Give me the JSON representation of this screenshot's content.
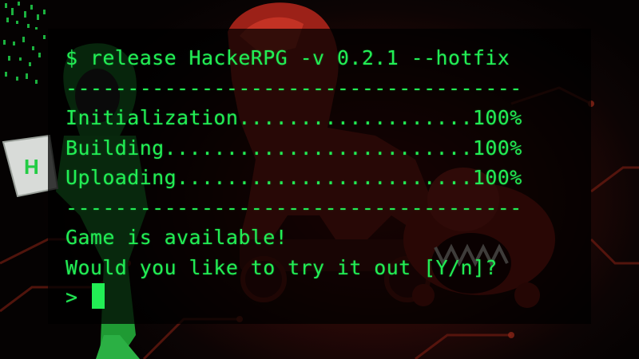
{
  "terminal": {
    "command": "$ release HackeRPG -v 0.2.1 --hotfix",
    "separator": "-------------------------------------",
    "steps": [
      {
        "line": "Initialization...................100%"
      },
      {
        "line": "Building.........................100%"
      },
      {
        "line": "Uploading........................100%"
      }
    ],
    "message": "Game is available!",
    "question": "Would you like to try it out [Y/n]?",
    "prompt": ">"
  },
  "art": {
    "laptop_letter": "H"
  },
  "colors": {
    "terminal_text": "#22ee55",
    "hacker_suit": "#1f9a33",
    "trojan_horse": "#a3241a",
    "background_glow": "#5a0d0a"
  },
  "icons": [
    "hacker-figure-icon",
    "trojan-horse-icon",
    "red-monster-icon",
    "matrix-code-icon",
    "laptop-icon"
  ]
}
